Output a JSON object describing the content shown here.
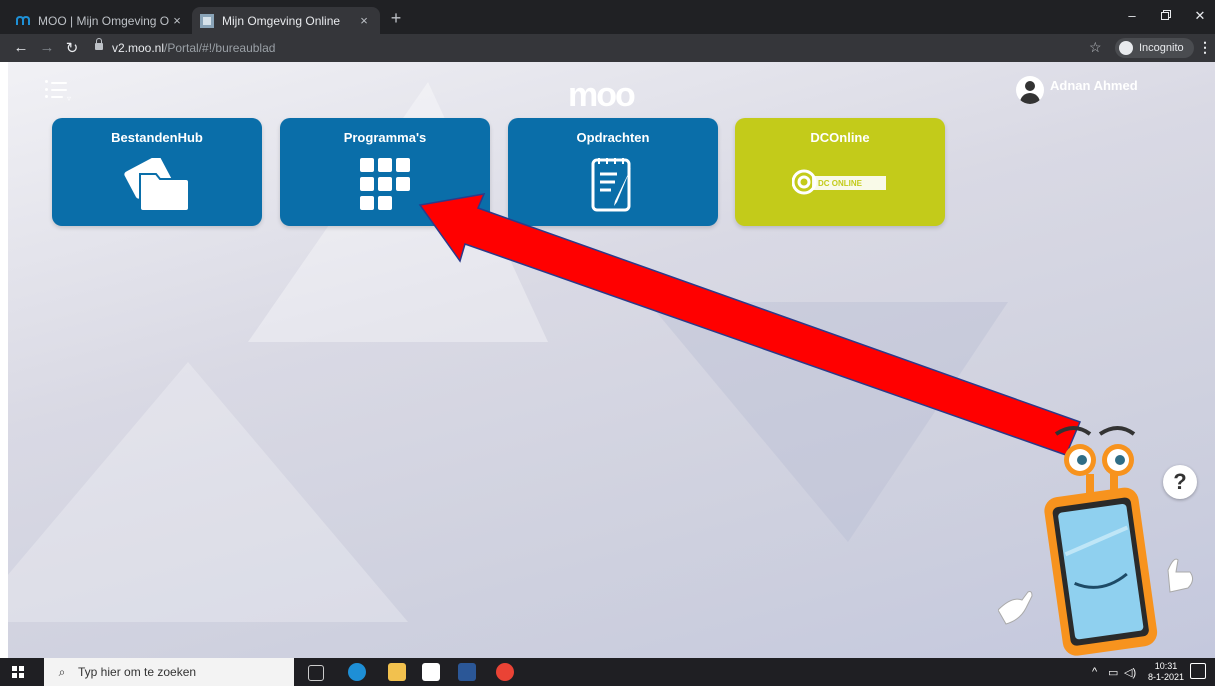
{
  "browser": {
    "tabs": [
      {
        "title": "MOO | Mijn Omgeving Online",
        "active": false
      },
      {
        "title": "Mijn Omgeving Online",
        "active": true
      }
    ],
    "new_tab": "+",
    "close_glyph": "×",
    "url_host": "v2.moo.nl",
    "url_path": "/Portal/#!/bureaublad",
    "incognito_label": "Incognito"
  },
  "header": {
    "logo_text": "moo",
    "user_name": "Adnan Ahmed"
  },
  "tiles": [
    {
      "label": "BestandenHub",
      "color": "#0a6ea9",
      "icon": "folder-icon"
    },
    {
      "label": "Programma's",
      "color": "#0a6ea9",
      "icon": "grid-icon"
    },
    {
      "label": "Opdrachten",
      "color": "#0a6ea9",
      "icon": "notepad-icon"
    },
    {
      "label": "DCOnline",
      "color": "#c3cb1a",
      "icon": "dconline-logo-icon",
      "logo_text": "DC ONLINE"
    }
  ],
  "help_glyph": "?",
  "taskbar": {
    "search_placeholder": "Typ hier om te zoeken",
    "time": "10:31",
    "date": "8-1-2021"
  },
  "colors": {
    "tile_blue": "#0a6ea9",
    "tile_green": "#c3cb1a",
    "arrow_red": "#ff0000"
  }
}
